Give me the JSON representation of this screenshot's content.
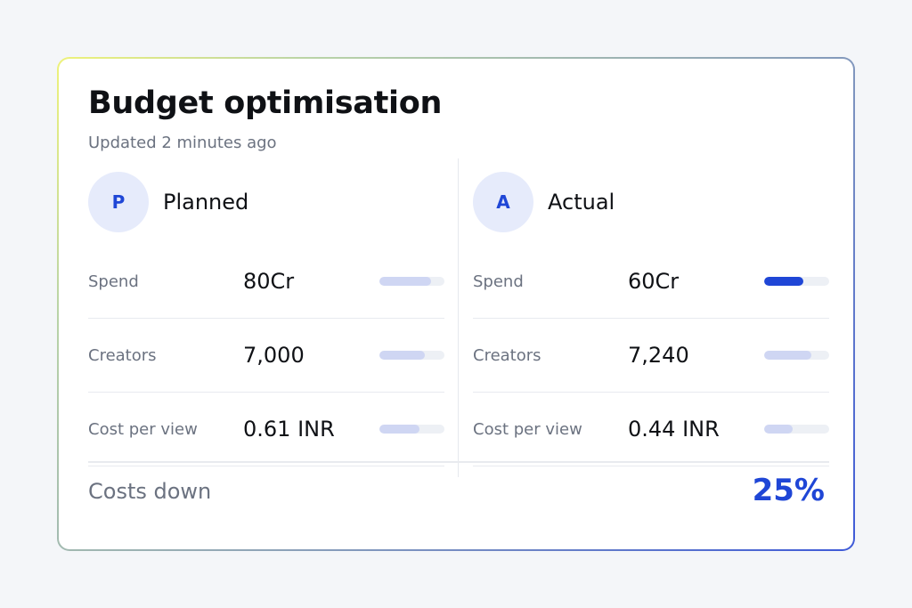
{
  "card": {
    "title": "Budget optimisation",
    "subtitle": "Updated 2 minutes ago"
  },
  "columns": [
    {
      "avatar": "P",
      "title": "Planned",
      "rows": [
        {
          "label": "Spend",
          "value": "80Cr",
          "fill": 0.8,
          "highlight": false
        },
        {
          "label": "Creators",
          "value": "7,000",
          "fill": 0.7,
          "highlight": false
        },
        {
          "label": "Cost per view",
          "value": "0.61 INR",
          "fill": 0.61,
          "highlight": false
        }
      ]
    },
    {
      "avatar": "A",
      "title": "Actual",
      "rows": [
        {
          "label": "Spend",
          "value": "60Cr",
          "fill": 0.6,
          "highlight": true
        },
        {
          "label": "Creators",
          "value": "7,240",
          "fill": 0.72,
          "highlight": false
        },
        {
          "label": "Cost per view",
          "value": "0.44 INR",
          "fill": 0.44,
          "highlight": false
        }
      ]
    }
  ],
  "footer": {
    "label": "Costs down",
    "value": "25%"
  },
  "colors": {
    "accent": "#1f46d6",
    "avatar_bg": "#e6ebfb",
    "bar_fill": "#cfd6f3",
    "bar_track": "#edf0f5"
  }
}
